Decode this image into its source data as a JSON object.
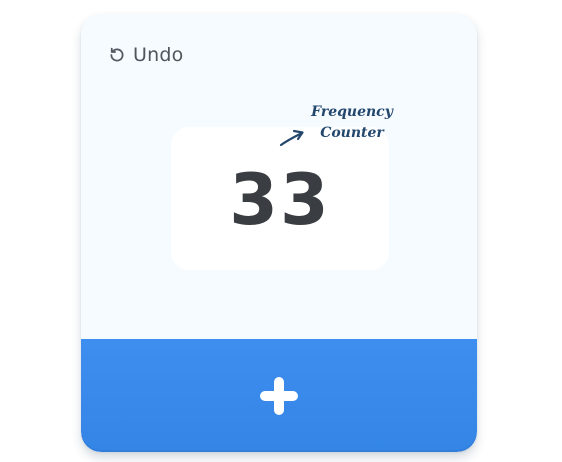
{
  "undo": {
    "label": "Undo",
    "icon": "undo-icon"
  },
  "counter": {
    "value": "33"
  },
  "annotation": {
    "line1": "Frequency",
    "line2": "Counter",
    "icon": "arrow-icon"
  },
  "add_button": {
    "icon": "plus-icon"
  },
  "colors": {
    "card_background": "#f5fbff",
    "display_background": "#ffffff",
    "accent": "#3a8aeb",
    "count_text": "#3a3d41",
    "annotation_text": "#24476d"
  }
}
